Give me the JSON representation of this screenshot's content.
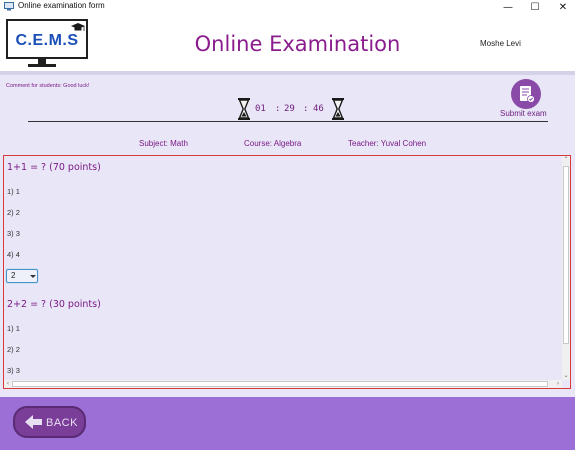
{
  "window": {
    "title": "Online examination form",
    "min_glyph": "—",
    "max_glyph": "☐",
    "close_glyph": "✕"
  },
  "header": {
    "logo_text": "C.E.M.S",
    "title": "Online Examination",
    "user_name": "Moshe Levi"
  },
  "exam": {
    "comment": "Comment for students: Good luck!",
    "timer": {
      "hours": "01",
      "minutes": "29",
      "seconds": "46",
      "separator": ":"
    },
    "submit_label": "Submit exam",
    "subject": "Subject: Math",
    "course": "Course: Algebra",
    "teacher": "Teacher: Yuval Cohen"
  },
  "questions": [
    {
      "title": "1+1 = ?  (70 points)",
      "options": [
        "1) 1",
        "2) 2",
        "3) 3",
        "4) 4"
      ],
      "selected": "2"
    },
    {
      "title": "2+2 = ?  (30 points)",
      "options": [
        "1) 1",
        "2) 2",
        "3) 3"
      ]
    }
  ],
  "footer": {
    "back_label": "BACK"
  },
  "colors": {
    "accent": "#8a1c8e",
    "footer": "#9b6fd6",
    "panel_border": "#d63a3a",
    "button": "#7a3e98"
  },
  "icons": [
    "app-icon",
    "graduation-cap-icon",
    "hourglass-icon",
    "document-check-icon",
    "back-arrow-icon"
  ]
}
